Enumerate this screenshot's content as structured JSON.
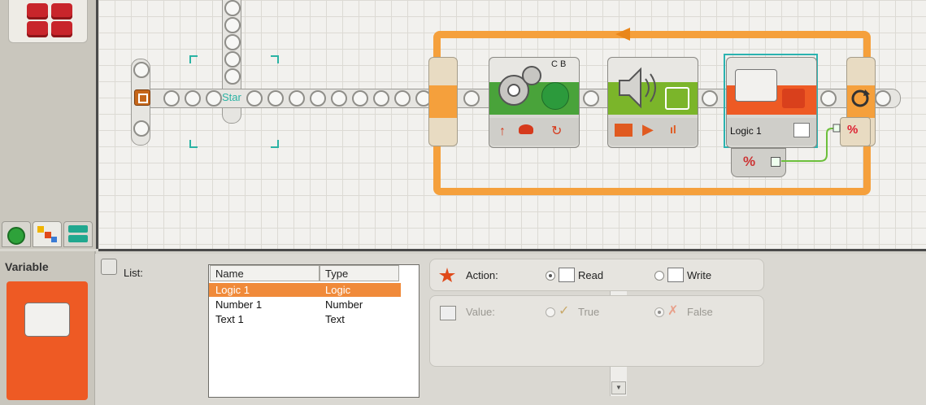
{
  "palette": {
    "tabs": [
      "common-palette-icon",
      "complete-palette-icon",
      "custom-palette-icon"
    ]
  },
  "canvas": {
    "start_label": "Star",
    "motor_block": {
      "ports_label": "C B"
    },
    "variable_block": {
      "name_label": "Logic 1"
    }
  },
  "config": {
    "block_title": "Variable",
    "list_label": "List:",
    "columns": [
      "Name",
      "Type"
    ],
    "rows": [
      {
        "name": "Logic 1",
        "type": "Logic"
      },
      {
        "name": "Number 1",
        "type": "Number"
      },
      {
        "name": "Text 1",
        "type": "Text"
      }
    ],
    "action_label": "Action:",
    "read_label": "Read",
    "write_label": "Write",
    "value_label": "Value:",
    "true_label": "True",
    "false_label": "False",
    "colors": {
      "accent": "#ee5a24",
      "loop": "#f5a03c",
      "selection": "#f08a3a"
    }
  }
}
